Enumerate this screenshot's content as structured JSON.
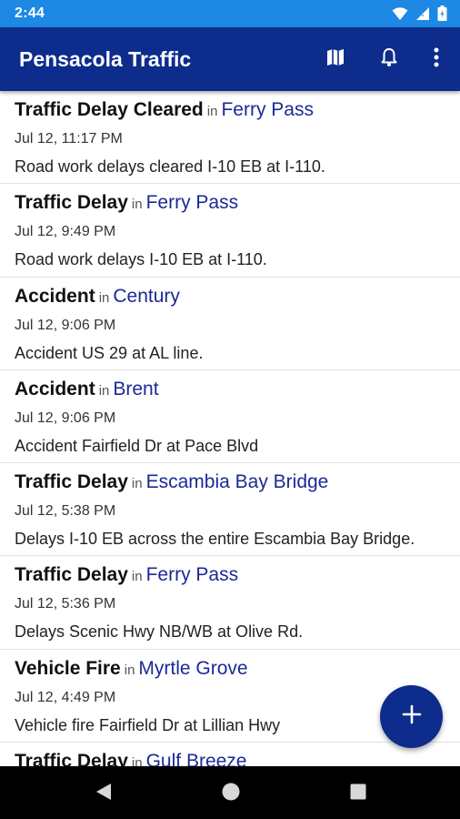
{
  "status_bar": {
    "time": "2:44"
  },
  "app_bar": {
    "title": "Pensacola Traffic",
    "actions": [
      {
        "icon": "map-icon"
      },
      {
        "icon": "bell-icon"
      },
      {
        "icon": "more-vert-icon"
      }
    ]
  },
  "feed": {
    "in_label": "in",
    "items": [
      {
        "type": "Traffic Delay Cleared",
        "place": "Ferry Pass",
        "date": "Jul 12, 11:17 PM",
        "description": "Road work delays cleared I-10 EB at I-110."
      },
      {
        "type": "Traffic Delay",
        "place": "Ferry Pass",
        "date": "Jul 12, 9:49 PM",
        "description": "Road work delays I-10 EB at I-110."
      },
      {
        "type": "Accident",
        "place": "Century",
        "date": "Jul 12, 9:06 PM",
        "description": "Accident US 29 at AL line."
      },
      {
        "type": "Accident",
        "place": "Brent",
        "date": "Jul 12, 9:06 PM",
        "description": "Accident Fairfield Dr at Pace Blvd"
      },
      {
        "type": "Traffic Delay",
        "place": "Escambia Bay Bridge",
        "date": "Jul 12, 5:38 PM",
        "description": "Delays I-10 EB across the entire Escambia Bay Bridge."
      },
      {
        "type": "Traffic Delay",
        "place": "Ferry Pass",
        "date": "Jul 12, 5:36 PM",
        "description": "Delays Scenic Hwy NB/WB at Olive Rd."
      },
      {
        "type": "Vehicle Fire",
        "place": "Myrtle Grove",
        "date": "Jul 12, 4:49 PM",
        "description": "Vehicle fire Fairfield Dr at Lillian Hwy"
      },
      {
        "type": "Traffic Delay",
        "place": "Gulf Breeze",
        "date": "",
        "description": ""
      }
    ]
  },
  "fab": {
    "icon": "plus-icon"
  },
  "nav_bar": {
    "buttons": [
      "back-icon",
      "home-icon",
      "recents-icon"
    ]
  },
  "colors": {
    "status_bar": "#1e88e5",
    "app_bar": "#0d2c8c",
    "place_link": "#1a2a95",
    "fab": "#0d2c8c"
  }
}
